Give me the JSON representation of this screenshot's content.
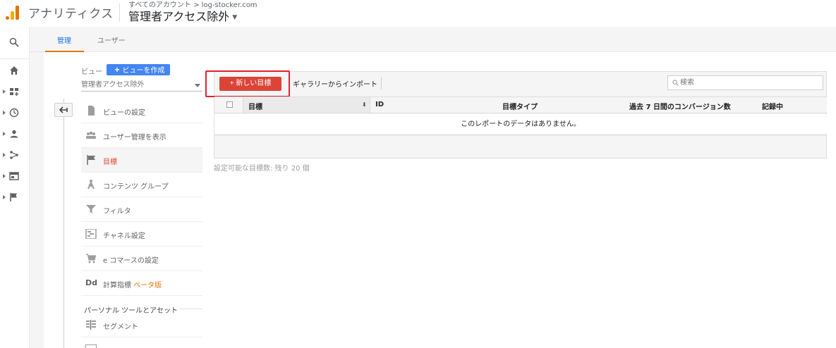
{
  "header": {
    "app_name": "アナリティクス",
    "breadcrumb": "すべてのアカウント > log-stocker.com",
    "view_title": "管理者アクセス除外"
  },
  "rail": {
    "items": [
      "search-icon",
      "home-icon",
      "dashboard-icon",
      "clock-icon",
      "person-icon",
      "acquisition-icon",
      "behavior-icon",
      "flag-icon"
    ]
  },
  "tabs": [
    {
      "label": "管理",
      "active": true
    },
    {
      "label": "ユーザー",
      "active": false
    }
  ],
  "side": {
    "view_label": "ビュー",
    "create_view_label": "ビューを作成",
    "view_selector": "管理者アクセス除外",
    "items": [
      {
        "label": "ビューの設定",
        "icon": "document-icon"
      },
      {
        "label": "ユーザー管理を表示",
        "icon": "users-icon"
      },
      {
        "label": "目標",
        "icon": "flag-icon",
        "active": true
      },
      {
        "label": "コンテンツ グループ",
        "icon": "content-group-icon"
      },
      {
        "label": "フィルタ",
        "icon": "filter-icon"
      },
      {
        "label": "チャネル設定",
        "icon": "channel-icon"
      },
      {
        "label": "e コマースの設定",
        "icon": "cart-icon"
      },
      {
        "label": "計算指標",
        "icon": "dd-icon",
        "badge": "ベータ版"
      }
    ],
    "section_title": "パーソナル ツールとアセット",
    "section_items": [
      {
        "label": "セグメント",
        "icon": "segment-icon"
      }
    ]
  },
  "goals": {
    "new_goal_label": "+ 新しい目標",
    "import_label": "ギャラリーからインポート",
    "search_placeholder": "検索",
    "columns": [
      "目標",
      "ID",
      "目標タイプ",
      "過去 7 日間のコンバージョン数",
      "記録中"
    ],
    "empty_message": "このレポートのデータはありません。",
    "footnote": "設定可能な目標数: 残り 20 個"
  },
  "colors": {
    "accent_blue": "#4285f4",
    "new_goal_red": "#db4437",
    "highlight_red": "#e5202e",
    "tab_underline": "#e37400"
  }
}
